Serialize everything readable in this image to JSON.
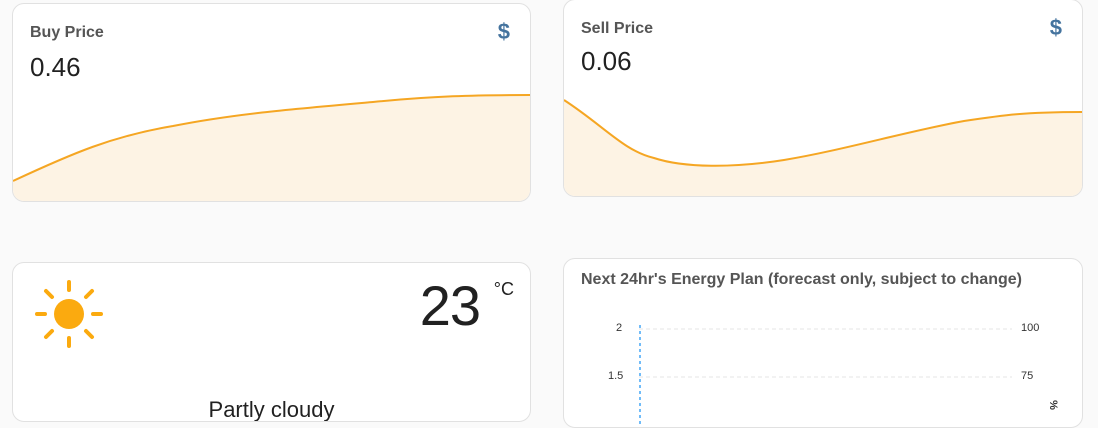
{
  "buy_price": {
    "name": "Buy Price",
    "state": "0.46",
    "icon": "currency-usd-icon",
    "icon_glyph": "$",
    "color": "#ffa726"
  },
  "sell_price": {
    "name": "Sell Price",
    "state": "0.06",
    "icon": "currency-usd-icon",
    "icon_glyph": "$",
    "color": "#ffa726"
  },
  "weather": {
    "temperature": "23",
    "unit": "°C",
    "condition": "Partly cloudy",
    "icon": "sun-icon",
    "sun_color": "#fbaa0f"
  },
  "energy_plan": {
    "title": "Next 24hr's Energy Plan (forecast only, subject to change)",
    "left_axis_ticks": [
      "2",
      "1.5"
    ],
    "right_axis_ticks": [
      "100",
      "75"
    ],
    "right_axis_unit_fragment": "%"
  },
  "colors": {
    "line": "#f5a623",
    "fill": "#fdf3e4",
    "icon": "#44739e",
    "now_line": "#42a5f5"
  }
}
